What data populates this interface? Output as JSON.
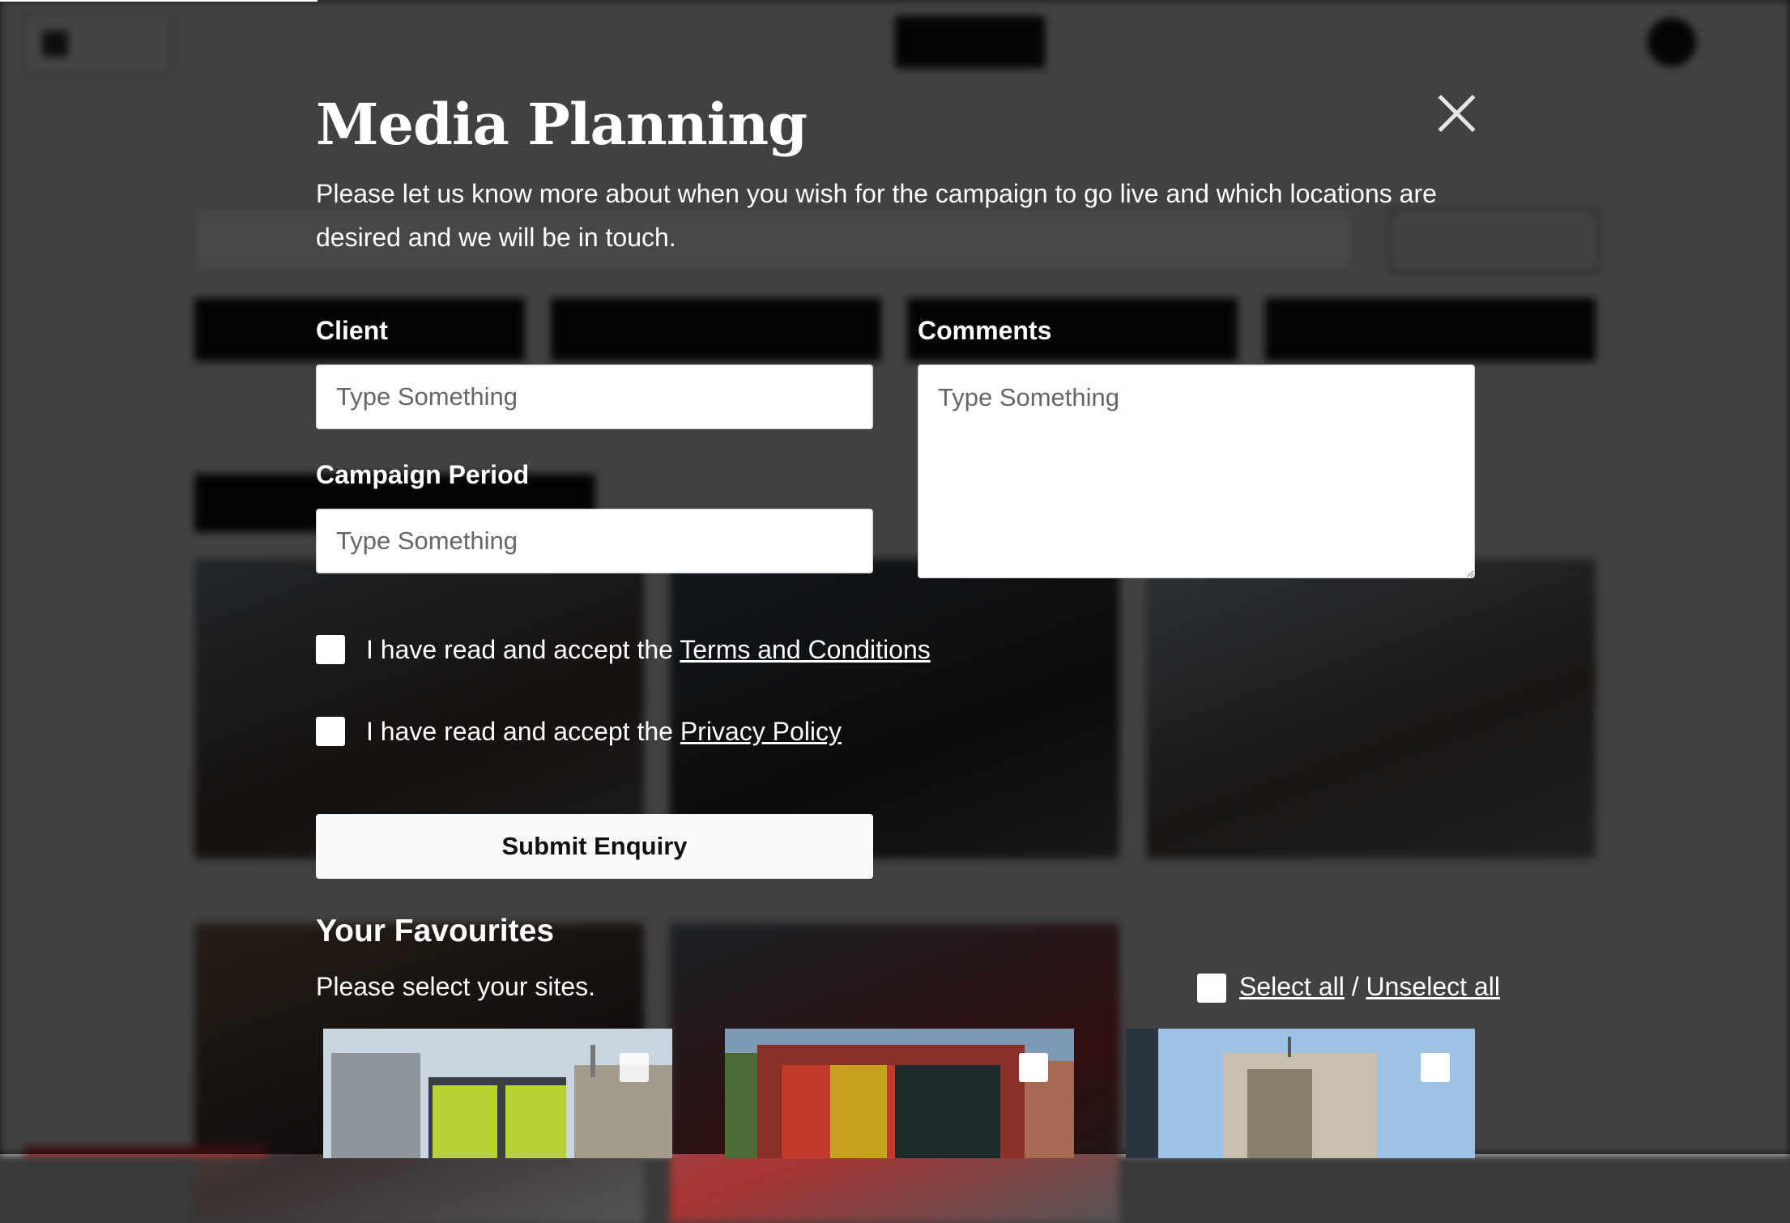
{
  "modal": {
    "title": "Media Planning",
    "description": "Please let us know more about when you wish for the campaign to go live and which locations are desired and we will be in touch."
  },
  "form": {
    "client_label": "Client",
    "client_placeholder": "Type Something",
    "period_label": "Campaign Period",
    "period_placeholder": "Type Something",
    "comments_label": "Comments",
    "comments_placeholder": "Type Something",
    "terms_prefix": "I have read and accept the ",
    "terms_link": "Terms and Conditions",
    "privacy_prefix": "I have read and accept the ",
    "privacy_link": "Privacy Policy",
    "submit_label": "Submit Enquiry"
  },
  "favourites": {
    "title": "Your Favourites",
    "subtitle": "Please select your sites.",
    "select_all": "Select all",
    "separator": " / ",
    "unselect_all": "Unselect all"
  },
  "icons": {
    "close": "close-icon",
    "checkbox": "checkbox-icon"
  },
  "colors": {
    "overlay": "#000000b8",
    "text": "#ffffff",
    "button_bg": "#f8f9fa",
    "input_bg": "#ffffff"
  }
}
